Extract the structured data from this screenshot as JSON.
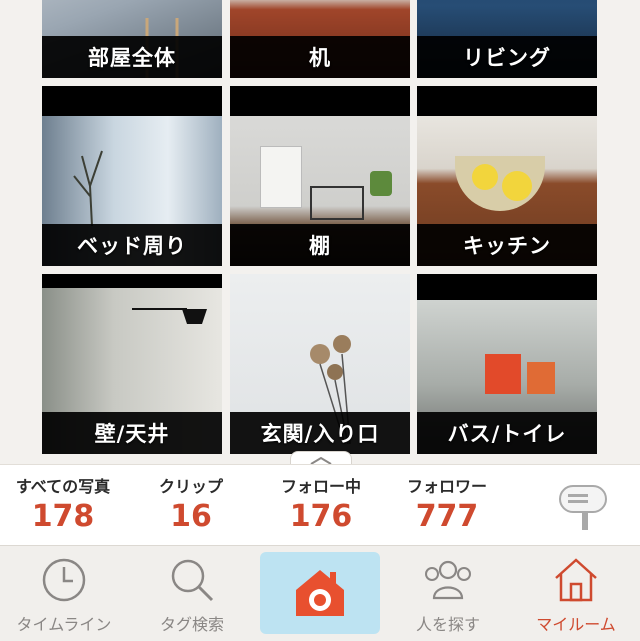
{
  "tiles": [
    {
      "label": "部屋全体"
    },
    {
      "label": "机"
    },
    {
      "label": "リビング"
    },
    {
      "label": "ベッド周り"
    },
    {
      "label": "棚"
    },
    {
      "label": "キッチン"
    },
    {
      "label": "壁/天井"
    },
    {
      "label": "玄関/入り口"
    },
    {
      "label": "バス/トイレ"
    }
  ],
  "stats": [
    {
      "caption": "すべての写真",
      "value": "178"
    },
    {
      "caption": "クリップ",
      "value": "16"
    },
    {
      "caption": "フォロー中",
      "value": "176"
    },
    {
      "caption": "フォロワー",
      "value": "777"
    }
  ],
  "tabs": [
    {
      "label": "タイムライン",
      "icon": "clock-icon"
    },
    {
      "label": "タグ検索",
      "icon": "search-icon"
    },
    {
      "label": "",
      "icon": "camera-house-icon"
    },
    {
      "label": "人を探す",
      "icon": "people-icon"
    },
    {
      "label": "マイルーム",
      "icon": "home-icon"
    }
  ],
  "colors": {
    "accent": "#cf4a2f",
    "camera_bg": "#bde3f2",
    "tab_inactive": "#8a8785"
  }
}
